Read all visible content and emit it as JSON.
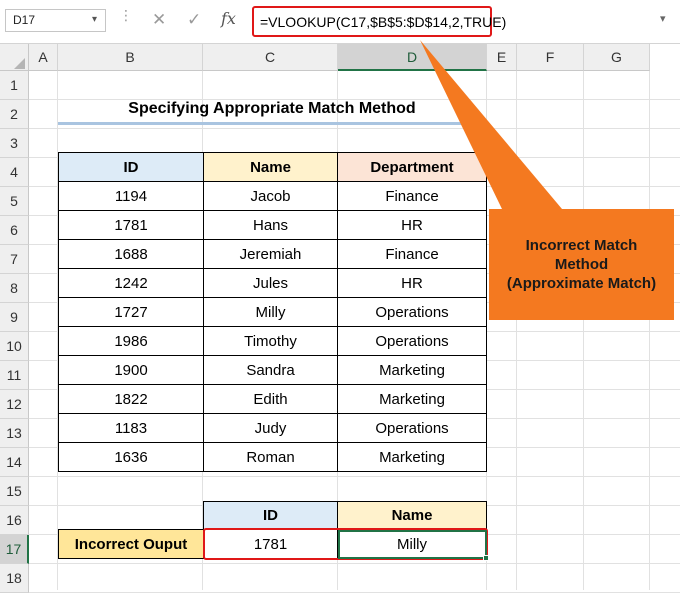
{
  "formula_bar": {
    "name_box": "D17",
    "name_box_arrow": "▾",
    "dots": "⋮",
    "cancel_icon": "✕",
    "enter_icon": "✓",
    "fx": "fx",
    "formula": "=VLOOKUP(C17,$B$5:$D$14,2,TRUE)",
    "expand_icon": "▾"
  },
  "columns": [
    "A",
    "B",
    "C",
    "D",
    "E",
    "F",
    "G"
  ],
  "rows": [
    "1",
    "2",
    "3",
    "4",
    "5",
    "6",
    "7",
    "8",
    "9",
    "10",
    "11",
    "12",
    "13",
    "14",
    "15",
    "16",
    "17",
    "18"
  ],
  "selected": {
    "column": "D",
    "row": "17"
  },
  "title": "Specifying Appropriate Match Method",
  "table": {
    "headers": [
      "ID",
      "Name",
      "Department"
    ],
    "rows": [
      [
        "1194",
        "Jacob",
        "Finance"
      ],
      [
        "1781",
        "Hans",
        "HR"
      ],
      [
        "1688",
        "Jeremiah",
        "Finance"
      ],
      [
        "1242",
        "Jules",
        "HR"
      ],
      [
        "1727",
        "Milly",
        "Operations"
      ],
      [
        "1986",
        "Timothy",
        "Operations"
      ],
      [
        "1900",
        "Sandra",
        "Marketing"
      ],
      [
        "1822",
        "Edith",
        "Marketing"
      ],
      [
        "1183",
        "Judy",
        "Operations"
      ],
      [
        "1636",
        "Roman",
        "Marketing"
      ]
    ]
  },
  "output": {
    "label": "Incorrect Ouput",
    "headers": [
      "ID",
      "Name"
    ],
    "values": [
      "1781",
      "Milly"
    ]
  },
  "callout": {
    "line1": "Incorrect Match",
    "line2": "Method",
    "line3": "(Approximate Match)"
  },
  "colors": {
    "id_header": "#ddebf7",
    "name_header": "#fff2cc",
    "dept_header": "#fce4d6",
    "callout": "#f47920",
    "highlight_border": "#e01818",
    "selection": "#217346"
  }
}
